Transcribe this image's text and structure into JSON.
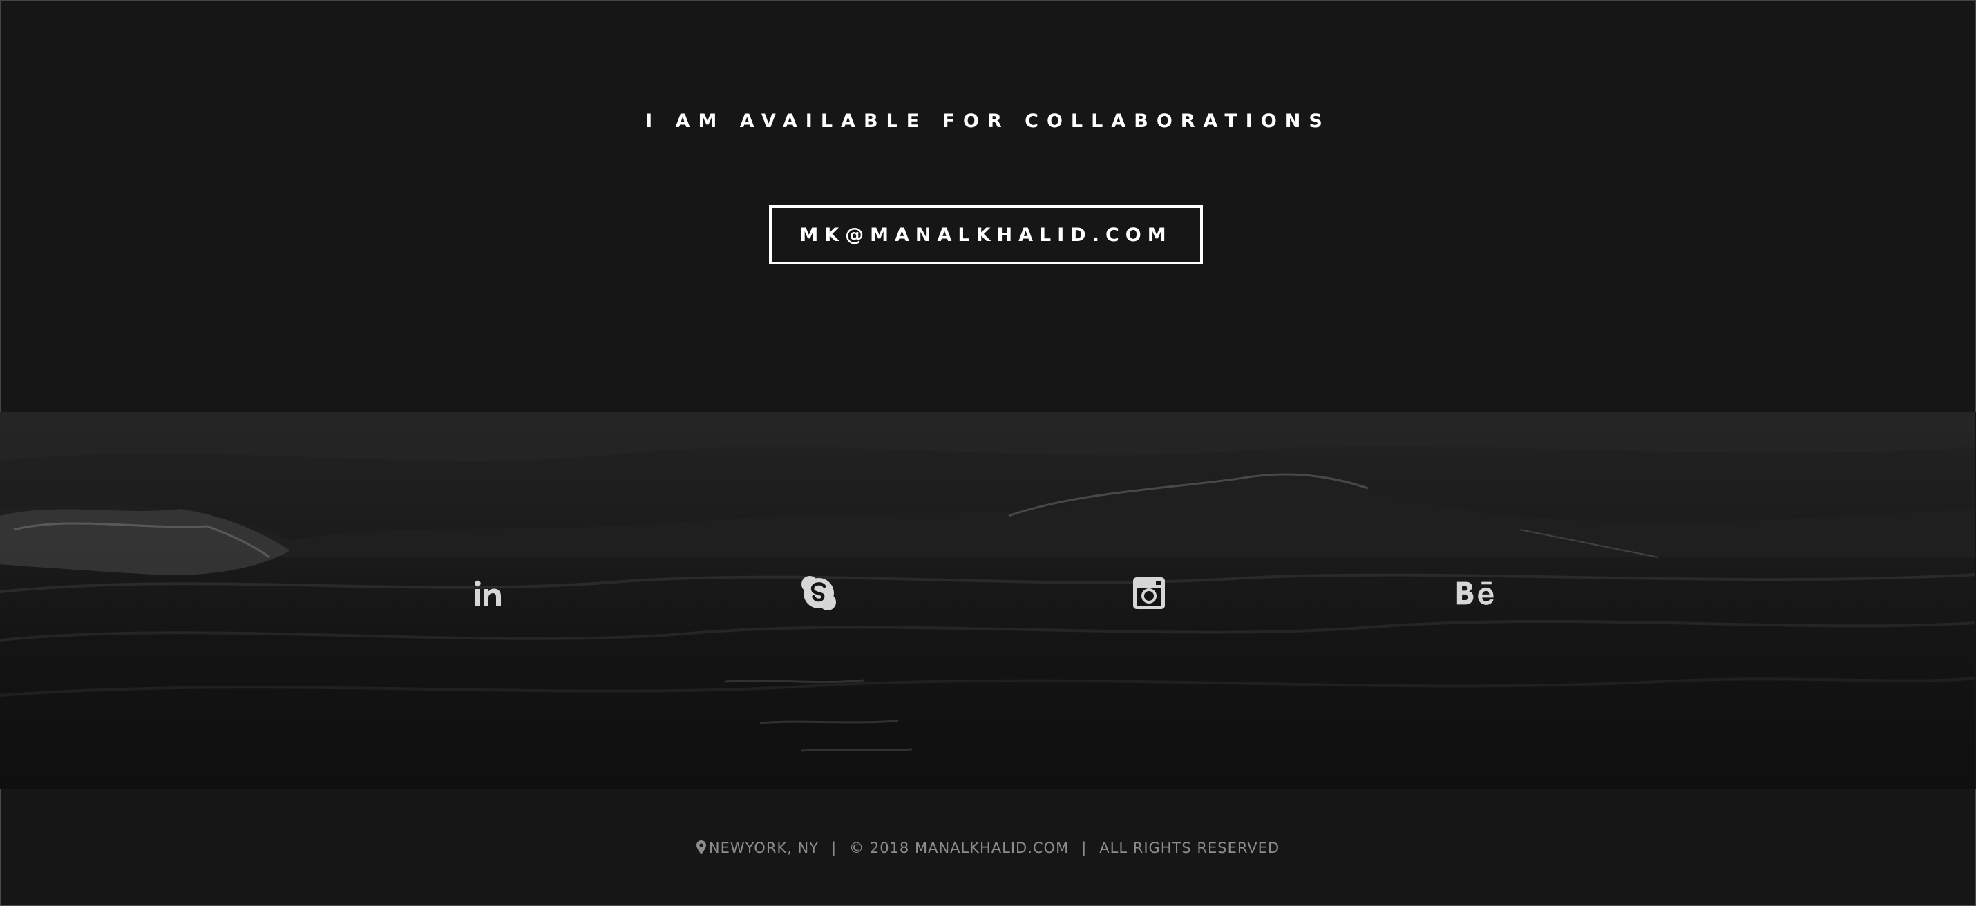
{
  "collaboration": {
    "heading": "I AM AVAILABLE FOR COLLABORATIONS",
    "email_button_label": "MK@MANALKHALID.COM"
  },
  "social": {
    "icons": [
      {
        "name": "linkedin-icon",
        "label": "in"
      },
      {
        "name": "skype-icon",
        "label": "S"
      },
      {
        "name": "instagram-icon",
        "label": ""
      },
      {
        "name": "behance-icon",
        "label": "Bē"
      }
    ],
    "icon_color": "#d6d6d6"
  },
  "footer": {
    "location": "NEWYORK, NY",
    "separator": "|",
    "copyright": "© 2018 MANALKHALID.COM",
    "rights": "ALL RIGHTS RESERVED"
  },
  "colors": {
    "background": "#161616",
    "text_primary": "#ffffff",
    "text_muted": "#8d8d8d"
  }
}
